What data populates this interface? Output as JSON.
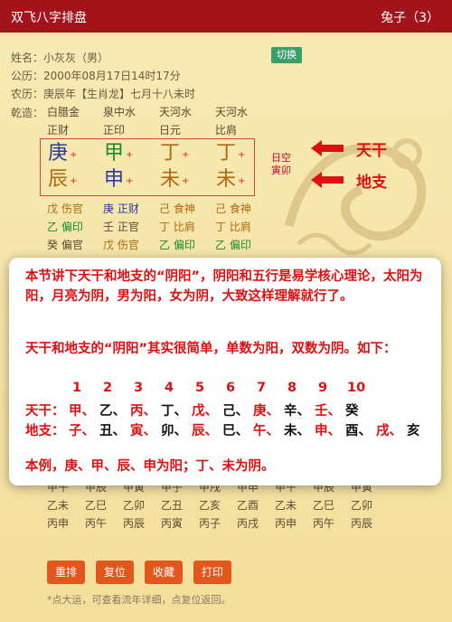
{
  "header": {
    "title": "双飞八字排盘",
    "user": "兔子（3）"
  },
  "info": {
    "name": "姓名：小灰灰（男）",
    "solar": "公历：2000年08月17日14时17分",
    "lunar": "农历：庚辰年【生肖龙】七月十八未时",
    "switch_label": "切换"
  },
  "qianzao": {
    "label": "乾造：",
    "nayin": [
      "白腊金",
      "泉中水",
      "天河水",
      "天河水"
    ],
    "shishen": [
      "正财",
      "正印",
      "日元",
      "比肩"
    ]
  },
  "stems": [
    {
      "char": "庚",
      "color": "#2a3aa0"
    },
    {
      "char": "甲",
      "color": "#1a8a2a"
    },
    {
      "char": "丁",
      "color": "#b06a10"
    },
    {
      "char": "丁",
      "color": "#b06a10"
    }
  ],
  "branches": [
    {
      "char": "辰",
      "color": "#b06a10"
    },
    {
      "char": "申",
      "color": "#2a3aa0"
    },
    {
      "char": "未",
      "color": "#b06a10"
    },
    {
      "char": "未",
      "color": "#b06a10"
    }
  ],
  "plus_sign": "+",
  "kongwang": {
    "line1": "日空",
    "line2": "寅卯"
  },
  "annotations": {
    "tiangan": "天干",
    "dizhi": "地支",
    "arrow_color": "#e01010"
  },
  "hidden_stems": [
    [
      {
        "t": "戊 伤官",
        "c": "#b06a10"
      },
      {
        "t": "庚 正财",
        "c": "#2a3aa0"
      },
      {
        "t": "己 食神",
        "c": "#b06a10"
      },
      {
        "t": "己 食神",
        "c": "#b06a10"
      }
    ],
    [
      {
        "t": "乙 偏印",
        "c": "#1a8a2a"
      },
      {
        "t": "壬 正官",
        "c": "#5a4a32"
      },
      {
        "t": "丁 比肩",
        "c": "#b06a10"
      },
      {
        "t": "丁 比肩",
        "c": "#b06a10"
      }
    ],
    [
      {
        "t": "癸 偏官",
        "c": "#5a4a32"
      },
      {
        "t": "戊 伤官",
        "c": "#b06a10"
      },
      {
        "t": "乙 偏印",
        "c": "#1a8a2a"
      },
      {
        "t": "乙 偏印",
        "c": "#1a8a2a"
      }
    ]
  ],
  "overlay": {
    "p1": "本节讲下天干和地支的“阴阳”，阴阳和五行是易学核心理论，太阳为阳，月亮为阴，男为阳，女为阴，大致这样理解就行了。",
    "p2": "天干和地支的“阴阳”其实很简单，单数为阳，双数为阴。如下：",
    "numbers": [
      "1",
      "2",
      "3",
      "4",
      "5",
      "6",
      "7",
      "8",
      "9",
      "10"
    ],
    "tg_label": "天干：",
    "tg": [
      "甲、",
      "乙、",
      "丙、",
      "丁、",
      "戊、",
      "己、",
      "庚、",
      "辛、",
      "壬、",
      "癸"
    ],
    "tg_colors": [
      "#e01010",
      "#111111",
      "#e01010",
      "#111111",
      "#e01010",
      "#111111",
      "#e01010",
      "#111111",
      "#e01010",
      "#111111"
    ],
    "dz_label": "地支：",
    "dz": [
      "子、",
      "丑、",
      "寅、",
      "卯、",
      "辰、",
      "巳、",
      "午、",
      "未、",
      "申、",
      "酉、",
      "戌、",
      "亥"
    ],
    "dz_colors": [
      "#e01010",
      "#111111",
      "#e01010",
      "#111111",
      "#e01010",
      "#111111",
      "#e01010",
      "#111111",
      "#e01010",
      "#111111",
      "#e01010",
      "#111111"
    ],
    "p3": "本例，庚、甲、辰、申为阳；丁、未为阴。"
  },
  "lower_grid": {
    "rows": [
      [
        "甲午",
        "甲辰",
        "甲寅",
        "甲子",
        "甲戌",
        "甲申",
        "甲午",
        "甲辰",
        "甲寅"
      ],
      [
        "乙未",
        "乙巳",
        "乙卯",
        "乙丑",
        "乙亥",
        "乙酉",
        "乙未",
        "乙巳",
        "乙卯"
      ],
      [
        "丙申",
        "丙午",
        "丙辰",
        "丙寅",
        "丙子",
        "丙戌",
        "丙申",
        "丙午",
        "丙辰"
      ]
    ]
  },
  "buttons": {
    "reset": "重排",
    "restore": "复位",
    "save": "收藏",
    "print": "打印"
  },
  "footnote": "*点大运，可查看流年详细，点复位返回。"
}
